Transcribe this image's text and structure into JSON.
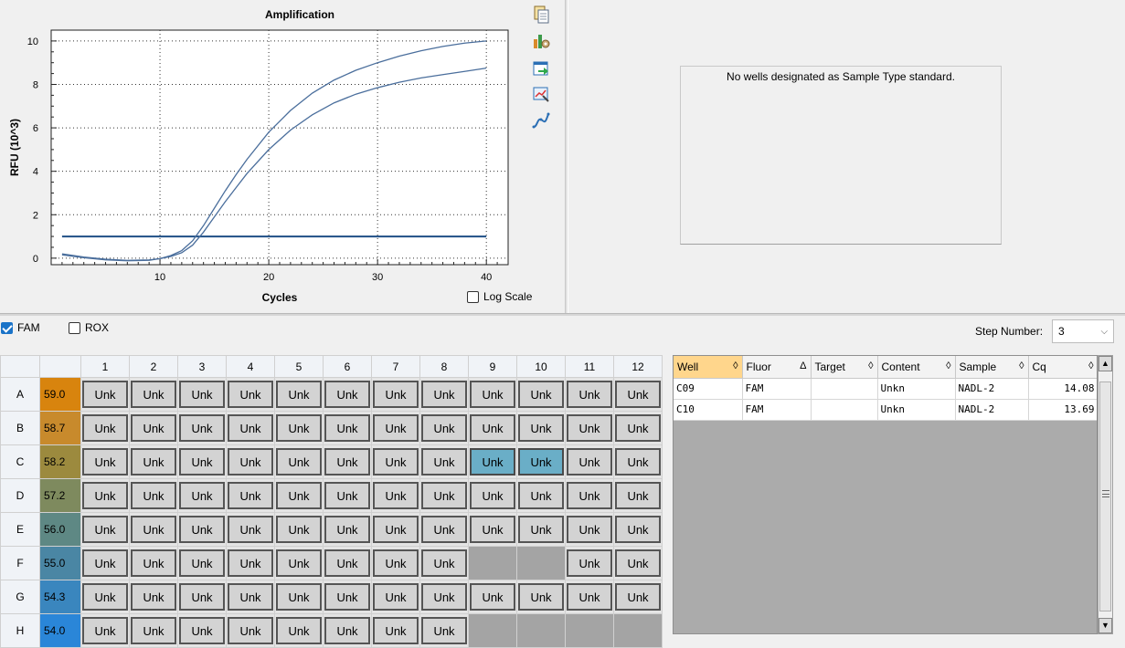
{
  "chart_data": {
    "type": "line",
    "title": "Amplification",
    "xlabel": "Cycles",
    "ylabel": "RFU (10^3)",
    "xlim": [
      0,
      42
    ],
    "ylim": [
      -0.3,
      10.5
    ],
    "xticks": [
      10,
      20,
      30,
      40
    ],
    "yticks": [
      0,
      2,
      4,
      6,
      8,
      10
    ],
    "grid": true,
    "threshold": 1.0,
    "series": [
      {
        "x": [
          1,
          3,
          5,
          7,
          9,
          10,
          11,
          12,
          13,
          14,
          15,
          16,
          17,
          18,
          20,
          22,
          24,
          26,
          28,
          30,
          32,
          34,
          36,
          38,
          40
        ],
        "values": [
          0.15,
          0.02,
          -0.08,
          -0.12,
          -0.1,
          -0.02,
          0.12,
          0.35,
          0.8,
          1.5,
          2.3,
          3.1,
          3.85,
          4.55,
          5.8,
          6.8,
          7.6,
          8.2,
          8.65,
          9.0,
          9.3,
          9.55,
          9.75,
          9.9,
          10.0
        ]
      },
      {
        "x": [
          1,
          3,
          5,
          7,
          9,
          10,
          11,
          12,
          13,
          14,
          15,
          16,
          17,
          18,
          20,
          22,
          24,
          26,
          28,
          30,
          32,
          34,
          36,
          38,
          40
        ],
        "values": [
          0.2,
          0.05,
          -0.05,
          -0.1,
          -0.08,
          -0.02,
          0.08,
          0.25,
          0.6,
          1.2,
          1.9,
          2.6,
          3.25,
          3.9,
          5.0,
          5.9,
          6.6,
          7.15,
          7.55,
          7.85,
          8.1,
          8.3,
          8.45,
          8.6,
          8.75
        ]
      }
    ],
    "colors": {
      "series": "#4a6e9c",
      "threshold": "#1f4f86"
    }
  },
  "log_scale": {
    "label": "Log Scale",
    "checked": false
  },
  "standard_curve_message": "No wells designated as Sample Type standard.",
  "fluors": [
    {
      "label": "FAM",
      "checked": true
    },
    {
      "label": "ROX",
      "checked": false
    }
  ],
  "step_number": {
    "label": "Step Number:",
    "value": "3"
  },
  "plate": {
    "columns": [
      "1",
      "2",
      "3",
      "4",
      "5",
      "6",
      "7",
      "8",
      "9",
      "10",
      "11",
      "12"
    ],
    "rows": [
      {
        "label": "A",
        "temp": "59.0",
        "color": "#d8840e",
        "wells": [
          "Unk",
          "Unk",
          "Unk",
          "Unk",
          "Unk",
          "Unk",
          "Unk",
          "Unk",
          "Unk",
          "Unk",
          "Unk",
          "Unk"
        ]
      },
      {
        "label": "B",
        "temp": "58.7",
        "color": "#c88a2c",
        "wells": [
          "Unk",
          "Unk",
          "Unk",
          "Unk",
          "Unk",
          "Unk",
          "Unk",
          "Unk",
          "Unk",
          "Unk",
          "Unk",
          "Unk"
        ]
      },
      {
        "label": "C",
        "temp": "58.2",
        "color": "#9c8a3e",
        "wells": [
          "Unk",
          "Unk",
          "Unk",
          "Unk",
          "Unk",
          "Unk",
          "Unk",
          "Unk",
          "Unk",
          "Unk",
          "Unk",
          "Unk"
        ]
      },
      {
        "label": "D",
        "temp": "57.2",
        "color": "#7e8a5e",
        "wells": [
          "Unk",
          "Unk",
          "Unk",
          "Unk",
          "Unk",
          "Unk",
          "Unk",
          "Unk",
          "Unk",
          "Unk",
          "Unk",
          "Unk"
        ]
      },
      {
        "label": "E",
        "temp": "56.0",
        "color": "#5e8884",
        "wells": [
          "Unk",
          "Unk",
          "Unk",
          "Unk",
          "Unk",
          "Unk",
          "Unk",
          "Unk",
          "Unk",
          "Unk",
          "Unk",
          "Unk"
        ]
      },
      {
        "label": "F",
        "temp": "55.0",
        "color": "#4a86a4",
        "wells": [
          "Unk",
          "Unk",
          "Unk",
          "Unk",
          "Unk",
          "Unk",
          "Unk",
          "Unk",
          "",
          "",
          "Unk",
          "Unk"
        ]
      },
      {
        "label": "G",
        "temp": "54.3",
        "color": "#3a86be",
        "wells": [
          "Unk",
          "Unk",
          "Unk",
          "Unk",
          "Unk",
          "Unk",
          "Unk",
          "Unk",
          "Unk",
          "Unk",
          "Unk",
          "Unk"
        ]
      },
      {
        "label": "H",
        "temp": "54.0",
        "color": "#2a86d8",
        "wells": [
          "Unk",
          "Unk",
          "Unk",
          "Unk",
          "Unk",
          "Unk",
          "Unk",
          "Unk",
          "",
          "",
          "",
          ""
        ]
      }
    ],
    "selected": [
      "C9",
      "C10"
    ]
  },
  "results": {
    "columns": [
      {
        "label": "Well",
        "sort": "◊"
      },
      {
        "label": "Fluor",
        "sort": "Δ"
      },
      {
        "label": "Target",
        "sort": "◊"
      },
      {
        "label": "Content",
        "sort": "◊"
      },
      {
        "label": "Sample",
        "sort": "◊"
      },
      {
        "label": "Cq",
        "sort": "◊"
      }
    ],
    "rows": [
      [
        "C09",
        "FAM",
        "",
        "Unkn",
        "NADL-2",
        "14.08"
      ],
      [
        "C10",
        "FAM",
        "",
        "Unkn",
        "NADL-2",
        "13.69"
      ]
    ]
  },
  "icons": {
    "tools": [
      "copy-icon",
      "chart-settings-icon",
      "export-icon",
      "zoom-chart-icon",
      "curve-icon"
    ]
  }
}
